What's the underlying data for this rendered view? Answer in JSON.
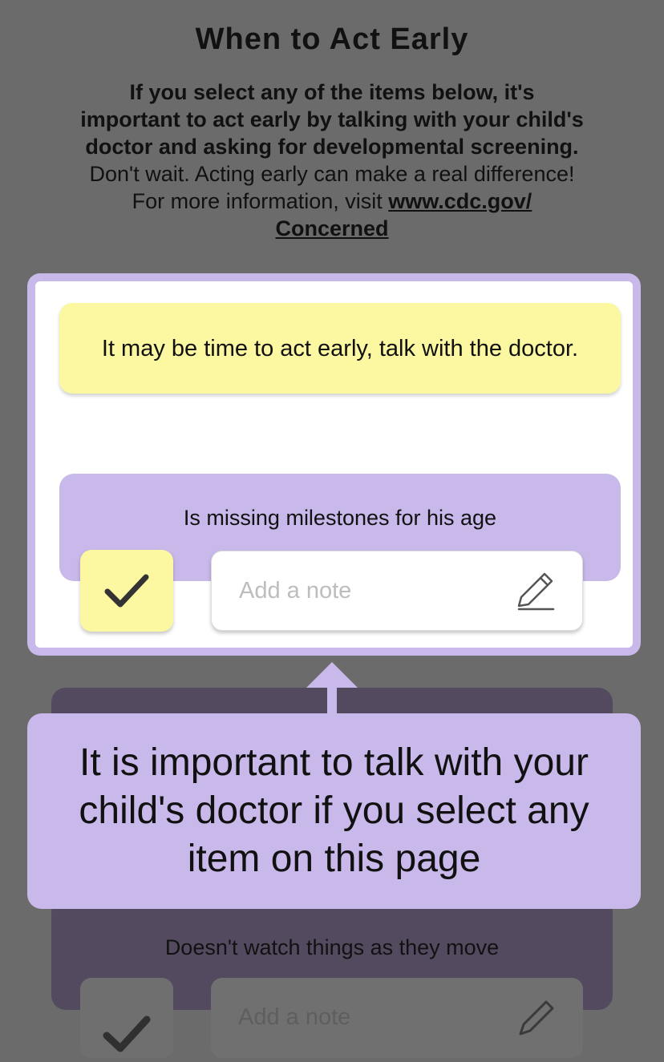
{
  "page": {
    "title": "When to Act Early",
    "intro_bold": "If you select any of the items below, it's important to act early by talking with your child's doctor and asking for developmental screening.",
    "intro_text": " Don't wait. Acting early can make a real difference! For more information, visit ",
    "intro_link": "www.cdc.gov/ Concerned"
  },
  "highlight": {
    "banner": "It may be time to act early, talk with the doctor.",
    "item_label": "Is missing milestones for his age",
    "item_checked": true,
    "note_placeholder": "Add a note"
  },
  "tooltip": {
    "text": "It is important to talk with your child's doctor if you select any item on this page"
  },
  "background_item": {
    "label": "Doesn't watch things as they move",
    "note_placeholder": "Add a note"
  },
  "colors": {
    "overlay": "#6b6b6b",
    "lavender": "#c9b8ea",
    "yellow": "#fbf8a1"
  },
  "icons": [
    "checkmark-icon",
    "pencil-icon",
    "arrow-up-icon"
  ]
}
